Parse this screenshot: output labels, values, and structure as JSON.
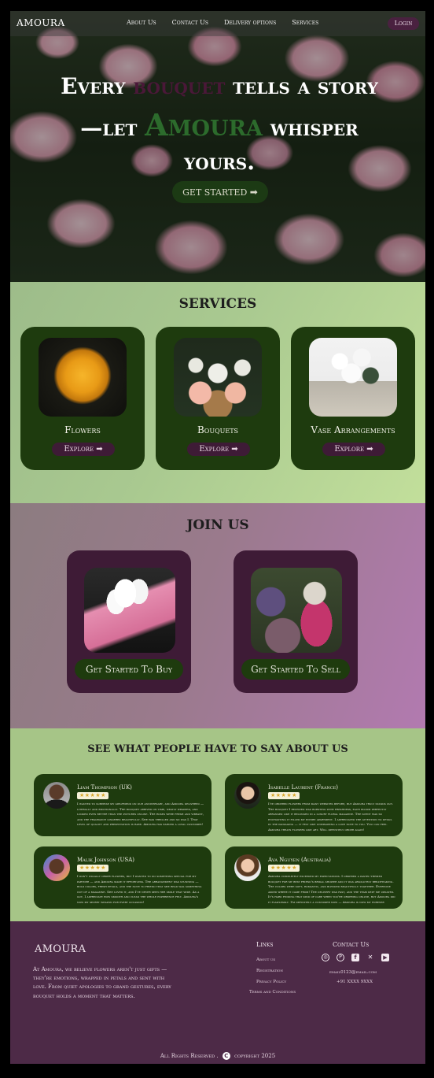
{
  "nav": {
    "brand": "AMOURA",
    "links": [
      "About Us",
      "Contact Us",
      "Delivery options",
      "Services"
    ],
    "login": "Login"
  },
  "hero": {
    "line1_a": "Every ",
    "line1_b": "bouquet",
    "line1_c": " tells a story",
    "line2_a": "—let ",
    "line2_b": "Amoura",
    "line2_c": " whisper",
    "line3": "yours.",
    "cta": "GET STARTED",
    "cta_icon": "arrow-right-icon"
  },
  "services": {
    "title": "SERVICES",
    "cards": [
      {
        "name": "Flowers",
        "button": "Explore"
      },
      {
        "name": "Bouquets",
        "button": "Explore"
      },
      {
        "name": "Vase Arrangements",
        "button": "Explore"
      }
    ]
  },
  "join": {
    "title": "JOIN US",
    "buy_button": "Get Started To Buy",
    "sell_button": "Get Started To Sell"
  },
  "reviews": {
    "title": "SEE WHAT PEOPLE HAVE TO SAY ABOUT US",
    "stars": "★★★★★",
    "items": [
      {
        "name": "Liam Thompson (UK)",
        "text": "I wanted to surprise my girlfriend on our anniversary, and Amoura delivered — literally and emotionally. The bouquet arrived on time, neatly wrapped, and looked even better than the pictures online. The roses were fresh and vibrant, and the fragrance lingered beautifully. She was thrilled and so was I. That level of quality and presentation is rare. Amoura has earned a loyal customer!"
      },
      {
        "name": "Isabelle Laurent (France)",
        "text": "I've ordered flowers from many websites before, but Amoura truly stands out. The bouquet I received was bursting with freshness, each bloom perfectly arranged like it belonged in a luxury floral magazine. The scent was so enchanting it filled my entire apartment. I appreciated the attention to detail in the packaging — it felt like unwrapping a love note to you. You can feel Amoura treats flowers like art. Will definitely order again!"
      },
      {
        "name": "Malik Johnson (USA)",
        "text": "I don't usually order flowers, but I wanted to do something special for my partner — and Amoura made it effortless. The arrangement was stunning — bold colors, fresh petals, and the note to friend that she read was something out of a magazine. She loved it, and I've never seen her smile that wide. As a guy, I appreciate how smooth and clean the whole experience felt. Amoura's now my secret weapon for every occasion!"
      },
      {
        "name": "Ava Nguyen (Australia)",
        "text": "Amoura completely exceeded my expectations. I ordered a pastel-themed bouquet for my best friend's bridal shower and it was absolutely breathtaking. The colors were soft, romantic, and blended beautifully together. Everyone asked where it came from! The delivery was fast, and the team kept me updated. It's hard finding that kind of care when you're ordering online, but Amoura did it flawlessly. I'm definitely a customer now — Amoura is now my forever flower destination!"
      }
    ]
  },
  "footer": {
    "brand": "AMOURA",
    "about": "At Amoura, we believe flowers aren't just gifts — they're emotions, wrapped in petals and sent with love. From quiet apologies to grand gestures, every bouquet holds a moment that matters.",
    "links_title": "Links",
    "links": [
      "About us",
      "Registration",
      "Privacy Policy",
      "Terms and Conditions"
    ],
    "contact_title": "Contact Us",
    "social_icons": [
      "instagram-icon",
      "pinterest-icon",
      "facebook-icon",
      "x-icon",
      "youtube-icon"
    ],
    "email": "email0123@email.com",
    "phone": "+91 XXXX 9XXX",
    "rights": "All Rights Reserved .",
    "copyright": "copyright 2025"
  }
}
